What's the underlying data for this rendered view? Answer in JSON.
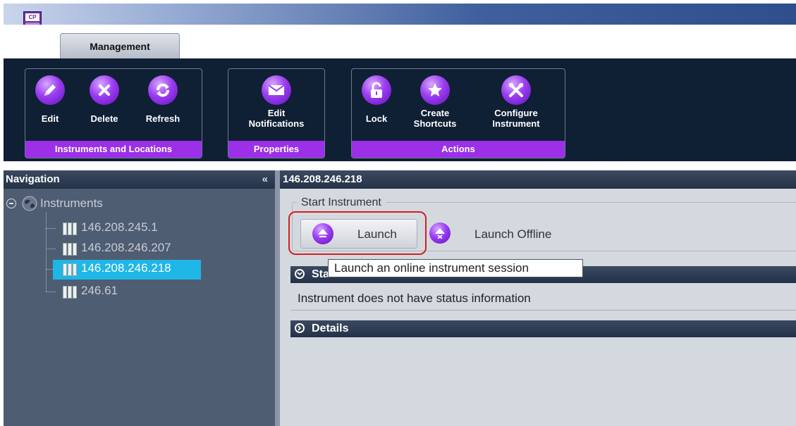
{
  "app": {
    "logo_icon": "app-logo-icon",
    "logo_text": "CP"
  },
  "tabs": [
    {
      "label": "Management",
      "active": true
    }
  ],
  "ribbon": {
    "accent": "#9b30e8",
    "groups": [
      {
        "title": "Instruments and Locations",
        "buttons": [
          {
            "label": "Edit",
            "icon": "pencil-icon"
          },
          {
            "label": "Delete",
            "icon": "x-icon"
          },
          {
            "label": "Refresh",
            "icon": "refresh-icon"
          }
        ]
      },
      {
        "title": "Properties",
        "buttons": [
          {
            "label": "Edit\nNotifications",
            "icon": "envelope-icon"
          }
        ]
      },
      {
        "title": "Actions",
        "buttons": [
          {
            "label": "Lock",
            "icon": "lock-icon"
          },
          {
            "label": "Create\nShortcuts",
            "icon": "star-icon"
          },
          {
            "label": "Configure\nInstrument",
            "icon": "tools-icon"
          }
        ]
      }
    ]
  },
  "navigation": {
    "title": "Navigation",
    "collapse_glyph": "«",
    "tree": {
      "root": {
        "label": "Instruments",
        "expanded": true
      },
      "items": [
        {
          "label": "146.208.245.1",
          "selected": false
        },
        {
          "label": "146.208.246.207",
          "selected": false
        },
        {
          "label": "146.208.246.218",
          "selected": true
        },
        {
          "label": "246.61",
          "selected": false
        }
      ]
    },
    "selected_color": "#1fb6e8"
  },
  "main": {
    "title": "146.208.246.218",
    "start_group": {
      "legend": "Start Instrument",
      "launch_label": "Launch",
      "launch_offline_label": "Launch Offline"
    },
    "tooltip": "Launch an online instrument session",
    "status_section": {
      "title": "Status",
      "text": "Instrument does not have status information"
    },
    "details_section": {
      "title": "Details"
    }
  }
}
